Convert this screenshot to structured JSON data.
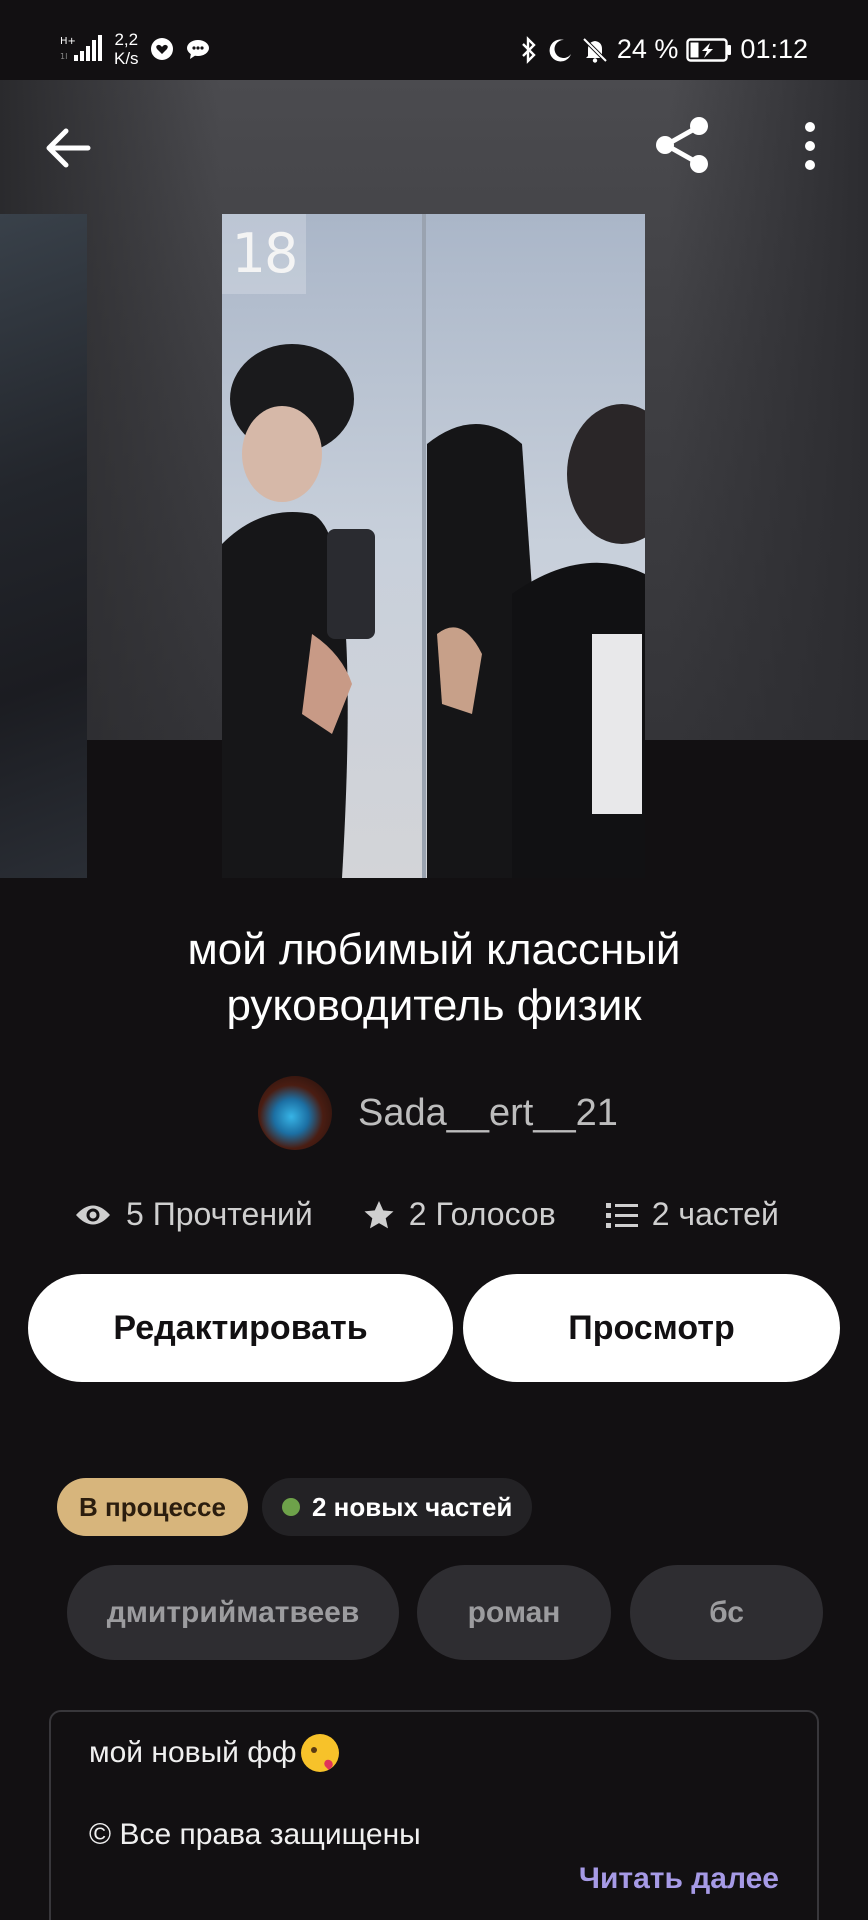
{
  "status_bar": {
    "net_speed_top": "2,2",
    "net_speed_bottom": "K/s",
    "battery": "24 %",
    "time": "01:12",
    "icons": [
      "signal-icon",
      "heart-chat-icon",
      "cloud-chat-icon",
      "bluetooth-icon",
      "moon-icon",
      "bell-off-icon",
      "battery-charging-icon"
    ]
  },
  "header": {
    "back_icon": "arrow-left-icon",
    "share_icon": "share-icon",
    "more_icon": "more-vertical-icon"
  },
  "cover": {
    "sign_text": "18"
  },
  "story": {
    "title_line1": "мой любимый классный",
    "title_line2": "руководитель физик",
    "author": "Sada__ert__21"
  },
  "stats": {
    "reads": "5 Прочтений",
    "votes": "2 Голосов",
    "parts": "2 частей"
  },
  "actions": {
    "edit": "Редактировать",
    "view": "Просмотр"
  },
  "status": {
    "badge": "В процессе",
    "new_parts": "2 новых частей"
  },
  "tags": [
    "дмитрийматвеев",
    "роман",
    "бс"
  ],
  "description": {
    "line1": "мой новый фф",
    "line2": "© Все права защищены",
    "read_more": "Читать далее"
  },
  "colors": {
    "background": "#121012",
    "status_badge": "#d7b57c",
    "new_dot": "#6ea24a",
    "read_more": "#a69ae6"
  }
}
